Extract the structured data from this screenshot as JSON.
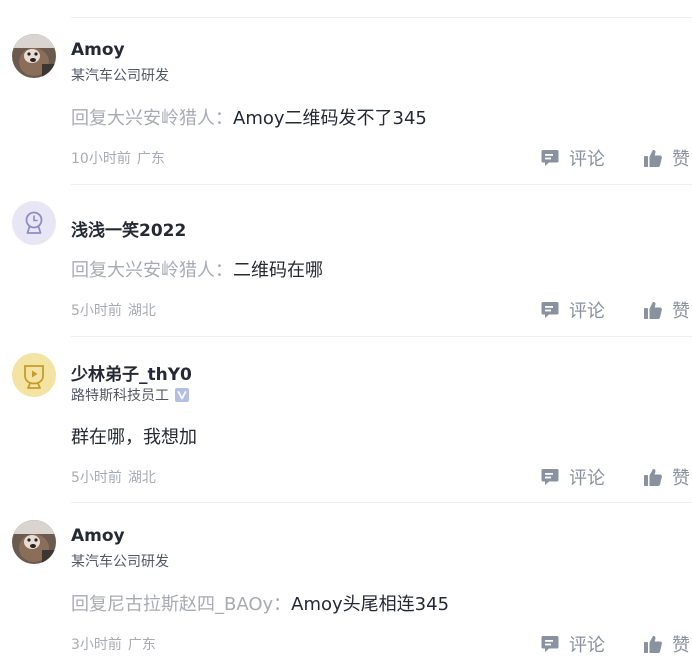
{
  "comments": [
    {
      "name": "Amoy",
      "title": "某汽车公司研发",
      "reply_prefix": "回复大兴安岭猎人：",
      "text": "Amoy二维码发不了345",
      "time": "10小时前",
      "location": "广东",
      "comment_label": "评论",
      "like_label": "赞",
      "avatar_icon": "dog-photo-avatar",
      "verified": false
    },
    {
      "name": "浅浅一笑2022",
      "title": "",
      "reply_prefix": "回复大兴安岭猎人：",
      "text": "二维码在哪",
      "time": "5小时前",
      "location": "湖北",
      "comment_label": "评论",
      "like_label": "赞",
      "avatar_icon": "clock-avatar",
      "verified": false
    },
    {
      "name": "少林弟子_thY0",
      "title": "路特斯科技员工",
      "reply_prefix": "",
      "text": "群在哪，我想加",
      "time": "5小时前",
      "location": "湖北",
      "comment_label": "评论",
      "like_label": "赞",
      "avatar_icon": "video-cup-avatar",
      "verified": true
    },
    {
      "name": "Amoy",
      "title": "某汽车公司研发",
      "reply_prefix": "回复尼古拉斯赵四_BAOy：",
      "text": "Amoy头尾相连345",
      "time": "3小时前",
      "location": "广东",
      "comment_label": "评论",
      "like_label": "赞",
      "avatar_icon": "dog-photo-avatar",
      "verified": false
    }
  ],
  "colors": {
    "name": "#252933",
    "secondary": "#a8abb3",
    "action": "#8a919f",
    "divider": "#eeeeee"
  }
}
